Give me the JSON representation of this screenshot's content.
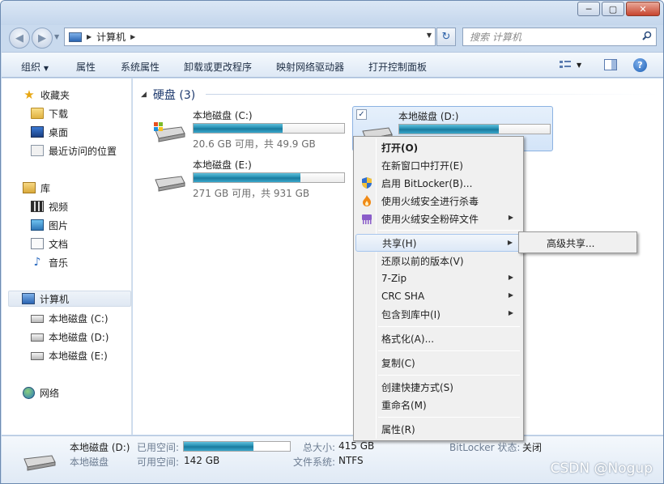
{
  "window": {
    "min": "─",
    "max": "▢",
    "close": "✕"
  },
  "address": {
    "path": "计算机",
    "search_placeholder": "搜索 计算机"
  },
  "toolbar": {
    "organize": "组织",
    "properties": "属性",
    "system_properties": "系统属性",
    "uninstall": "卸载或更改程序",
    "map_drive": "映射网络驱动器",
    "control_panel": "打开控制面板",
    "help": "?"
  },
  "sidebar": {
    "favorites": "收藏夹",
    "downloads": "下载",
    "desktop": "桌面",
    "recent": "最近访问的位置",
    "libraries": "库",
    "videos": "视频",
    "pictures": "图片",
    "documents": "文档",
    "music": "音乐",
    "computer": "计算机",
    "drive_c": "本地磁盘 (C:)",
    "drive_d": "本地磁盘 (D:)",
    "drive_e": "本地磁盘 (E:)",
    "network": "网络"
  },
  "main": {
    "group_title": "硬盘 (3)",
    "drives": [
      {
        "name": "本地磁盘 (C:)",
        "free": "20.6 GB 可用，共 49.9 GB",
        "used_fraction": 0.59
      },
      {
        "name": "本地磁盘 (D:)",
        "free": "",
        "used_fraction": 0.66
      },
      {
        "name": "本地磁盘 (E:)",
        "free": "271 GB 可用，共 931 GB",
        "used_fraction": 0.71
      }
    ]
  },
  "context_menu": {
    "items": [
      "打开(O)",
      "在新窗口中打开(E)",
      "启用 BitLocker(B)...",
      "使用火绒安全进行杀毒",
      "使用火绒安全粉碎文件",
      "共享(H)",
      "还原以前的版本(V)",
      "7-Zip",
      "CRC SHA",
      "包含到库中(I)",
      "格式化(A)...",
      "复制(C)",
      "创建快捷方式(S)",
      "重命名(M)",
      "属性(R)"
    ],
    "submenu_item": "高级共享..."
  },
  "details": {
    "name": "本地磁盘 (D:)",
    "type": "本地磁盘",
    "used_label": "已用空间:",
    "used_fraction": 0.66,
    "free_label": "可用空间:",
    "free_value": "142 GB",
    "total_label": "总大小:",
    "total_value": "415 GB",
    "fs_label": "文件系统:",
    "fs_value": "NTFS",
    "bitlocker_label": "BitLocker 状态:",
    "bitlocker_value": "关闭"
  },
  "watermark": "CSDN @Nogup",
  "colors": {
    "accent": "#1e89ad",
    "selection": "#d3e4f8",
    "menu_bg": "#f0f0f0"
  }
}
